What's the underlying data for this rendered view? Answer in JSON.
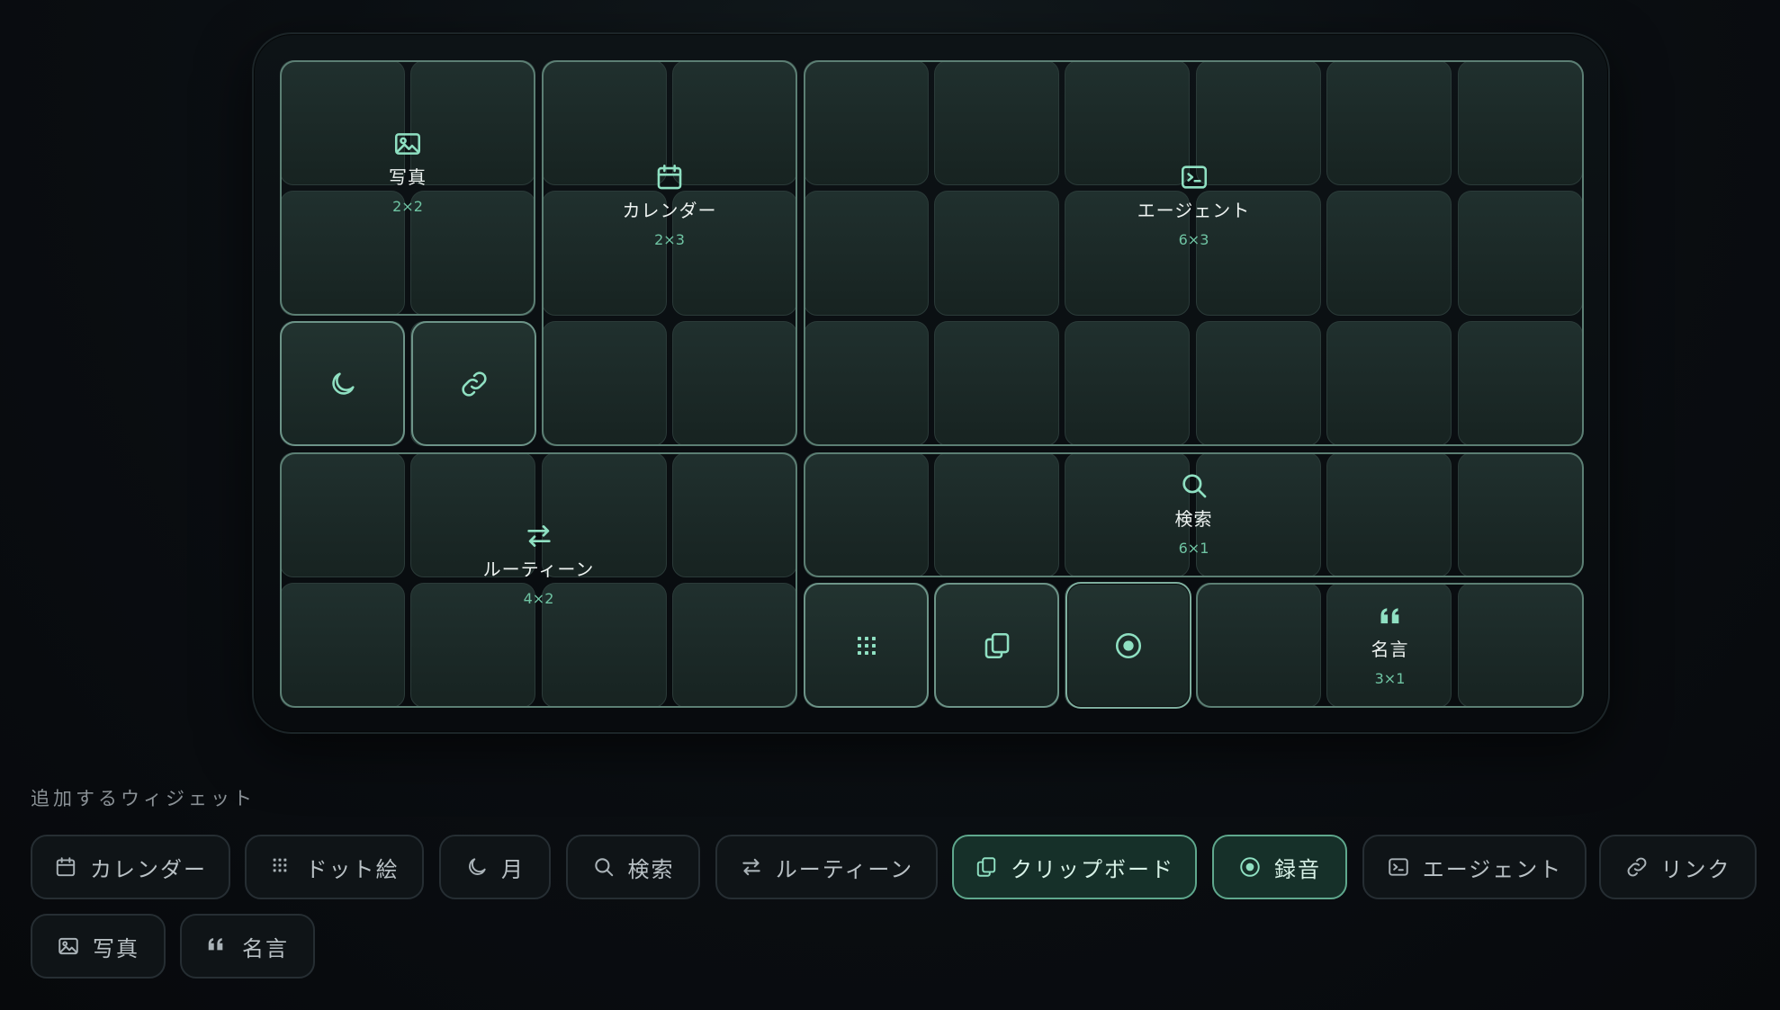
{
  "board": {
    "widgets": {
      "photo": {
        "title": "写真",
        "size": "2×2",
        "icon": "image-icon"
      },
      "calendar": {
        "title": "カレンダー",
        "size": "2×3",
        "icon": "calendar-icon"
      },
      "agent": {
        "title": "エージェント",
        "size": "6×3",
        "icon": "terminal-icon"
      },
      "moon": {
        "icon": "moon-icon"
      },
      "link": {
        "icon": "link-icon"
      },
      "routine": {
        "title": "ルーティーン",
        "size": "4×2",
        "icon": "swap-arrows-icon"
      },
      "search": {
        "title": "検索",
        "size": "6×1",
        "icon": "search-icon"
      },
      "dot_art": {
        "icon": "dot-grid-icon"
      },
      "clipboard": {
        "icon": "copy-icon"
      },
      "record": {
        "icon": "record-icon"
      },
      "quote": {
        "title": "名言",
        "size": "3×1",
        "icon": "quote-icon"
      }
    }
  },
  "picker": {
    "label": "追加するウィジェット",
    "chips": [
      {
        "label": "カレンダー",
        "icon": "calendar-icon",
        "selected": false
      },
      {
        "label": "ドット絵",
        "icon": "dot-grid-icon",
        "selected": false
      },
      {
        "label": "月",
        "icon": "moon-icon",
        "selected": false
      },
      {
        "label": "検索",
        "icon": "search-icon",
        "selected": false
      },
      {
        "label": "ルーティーン",
        "icon": "swap-arrows-icon",
        "selected": false
      },
      {
        "label": "クリップボード",
        "icon": "copy-icon",
        "selected": true
      },
      {
        "label": "録音",
        "icon": "record-icon",
        "selected": true
      },
      {
        "label": "エージェント",
        "icon": "terminal-icon",
        "selected": false
      },
      {
        "label": "リンク",
        "icon": "link-icon",
        "selected": false
      },
      {
        "label": "写真",
        "icon": "image-icon",
        "selected": false
      },
      {
        "label": "名言",
        "icon": "quote-icon",
        "selected": false
      }
    ]
  },
  "colors": {
    "accent": "#8fe0c2",
    "size_text": "#6fc4a3",
    "widget_border": "#5c7f74",
    "chip_selected_bg": "#163029",
    "chip_selected_border": "#5fa88d"
  }
}
